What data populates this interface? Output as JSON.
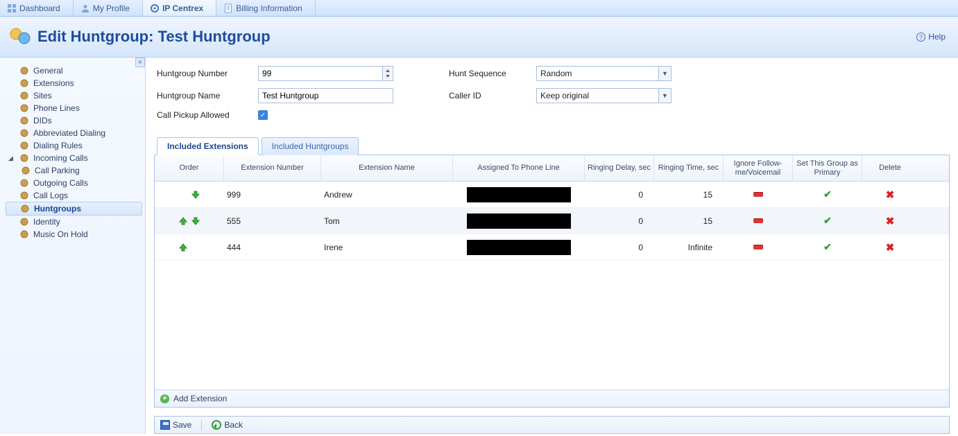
{
  "topTabs": [
    {
      "label": "Dashboard",
      "active": false
    },
    {
      "label": "My Profile",
      "active": false
    },
    {
      "label": "IP Centrex",
      "active": true
    },
    {
      "label": "Billing Information",
      "active": false
    }
  ],
  "pageTitle": "Edit Huntgroup: Test Huntgroup",
  "helpLabel": "Help",
  "sidebar": {
    "items": [
      {
        "label": "General",
        "sub": false
      },
      {
        "label": "Extensions",
        "sub": false
      },
      {
        "label": "Sites",
        "sub": false
      },
      {
        "label": "Phone Lines",
        "sub": false
      },
      {
        "label": "DIDs",
        "sub": false
      },
      {
        "label": "Abbreviated Dialing",
        "sub": false
      },
      {
        "label": "Dialing Rules",
        "sub": false
      },
      {
        "label": "Incoming Calls",
        "sub": false,
        "expanded": true
      },
      {
        "label": "Call Parking",
        "sub": true
      },
      {
        "label": "Outgoing Calls",
        "sub": false
      },
      {
        "label": "Call Logs",
        "sub": false
      },
      {
        "label": "Huntgroups",
        "sub": false,
        "selected": true
      },
      {
        "label": "Identity",
        "sub": false
      },
      {
        "label": "Music On Hold",
        "sub": false
      }
    ]
  },
  "form": {
    "huntgroupNumberLabel": "Huntgroup Number",
    "huntgroupNumberValue": "99",
    "huntgroupNameLabel": "Huntgroup Name",
    "huntgroupNameValue": "Test Huntgroup",
    "callPickupLabel": "Call Pickup Allowed",
    "huntSequenceLabel": "Hunt Sequence",
    "huntSequenceValue": "Random",
    "callerIdLabel": "Caller ID",
    "callerIdValue": "Keep original"
  },
  "subTabs": [
    {
      "label": "Included Extensions",
      "active": true
    },
    {
      "label": "Included Huntgroups",
      "active": false
    }
  ],
  "columns": {
    "order": "Order",
    "extNum": "Extension Number",
    "extName": "Extension Name",
    "assigned": "Assigned To Phone Line",
    "delay": "Ringing Delay, sec",
    "time": "Ringing Time, sec",
    "ignore": "Ignore Follow-me/Voicemail",
    "primary": "Set This Group as Primary",
    "delete": "Delete"
  },
  "rows": [
    {
      "up": false,
      "down": true,
      "extNum": "999",
      "extName": "Andrew",
      "delay": "0",
      "time": "15"
    },
    {
      "up": true,
      "down": true,
      "extNum": "555",
      "extName": "Tom",
      "delay": "0",
      "time": "15"
    },
    {
      "up": true,
      "down": false,
      "extNum": "444",
      "extName": "Irene",
      "delay": "0",
      "time": "Infinite"
    }
  ],
  "addExtensionLabel": "Add Extension",
  "toolbar": {
    "save": "Save",
    "back": "Back"
  }
}
